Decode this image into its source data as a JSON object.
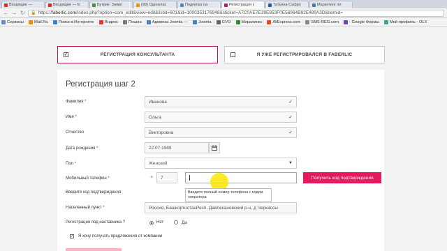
{
  "tabs": [
    {
      "label": "Входящие — ",
      "color": "#d93025"
    },
    {
      "label": "Входящие — fo",
      "color": "#d93025"
    },
    {
      "label": "Бутрик- Заявл",
      "color": "#4a8a4a"
    },
    {
      "label": "(99) Одноклас",
      "color": "#f08a0b"
    },
    {
      "label": "Подписка на ",
      "color": "#5b7fb5"
    },
    {
      "label": "Регистрация к",
      "color": "#c2185b",
      "active": true
    },
    {
      "label": "Татьяна Сафро",
      "color": "#3b5998"
    },
    {
      "label": "Маркетинг пл",
      "color": "#4a76a8"
    }
  ],
  "address": {
    "url_prefix": "https://",
    "url_host": "faberlic.com",
    "url_rest": "/index.php?option=com_edit&view=edit&listid=601&id=1000353176948&sticket=A7C0AE7E39E953F0E56964B82E489A3D&itemid="
  },
  "bookmarks": [
    {
      "label": "Сервисы",
      "color": "#6a8bc7"
    },
    {
      "label": "Mail.Ru",
      "color": "#f08a0b"
    },
    {
      "label": "Поиск в Интернете",
      "color": "#3b7fd1"
    },
    {
      "label": "Яндекс",
      "color": "#e53935"
    },
    {
      "label": "Пошла",
      "color": "#7a7a7a"
    },
    {
      "label": "Админка Joomla —",
      "color": "#4a7fc1"
    },
    {
      "label": "Joomla",
      "color": "#4a7fc1"
    },
    {
      "label": "GVO",
      "color": "#666"
    },
    {
      "label": "Миралинкс",
      "color": "#2f8f2f"
    },
    {
      "label": "AliExpress.com",
      "color": "#e64a19"
    },
    {
      "label": "SMS-REG.com",
      "color": "#888"
    },
    {
      "label": "- Google Формы",
      "color": "#7b3fb5"
    },
    {
      "label": "Мой профиль - OLX",
      "color": "#3a9"
    }
  ],
  "switch": {
    "consultant": "РЕГИСТРАЦИЯ КОНСУЛЬТАНТА",
    "already": "Я УЖЕ РЕГИСТРИРОВАЛСЯ В FABERLIC",
    "consultant_checkmark": "✓"
  },
  "form": {
    "title": "Регистрация шаг 2",
    "required_mark": "*",
    "labels": {
      "lastname": "Фамилия",
      "firstname": "Имя",
      "patronymic": "Отчество",
      "birthdate": "Дата рождения",
      "gender": "Пол",
      "phone": "Мобильный телефон",
      "code": "Введите код подтверждения",
      "city": "Населенный пункт",
      "mentor": "Регистрация под наставника ?",
      "offers": "Я хочу получать предложения от компании"
    },
    "values": {
      "lastname": "Иванова",
      "firstname": "Ольга",
      "patronymic": "Викторовна",
      "birthdate": "22.07.1989",
      "gender": "Женский",
      "phone_prefix": "+",
      "phone_code": "7",
      "phone": "",
      "city": "Россия, БашкортостанРесп, Давлекановский р-н, д Черкассы"
    },
    "checkmark": "✓",
    "get_code_button": "Получить код подтверждения",
    "phone_tooltip": "Введите полный номер телефона с кодом оператора",
    "mentor_no": "Нет",
    "mentor_yes": "Да",
    "mentor_selected": "no",
    "offers_checked": true
  }
}
